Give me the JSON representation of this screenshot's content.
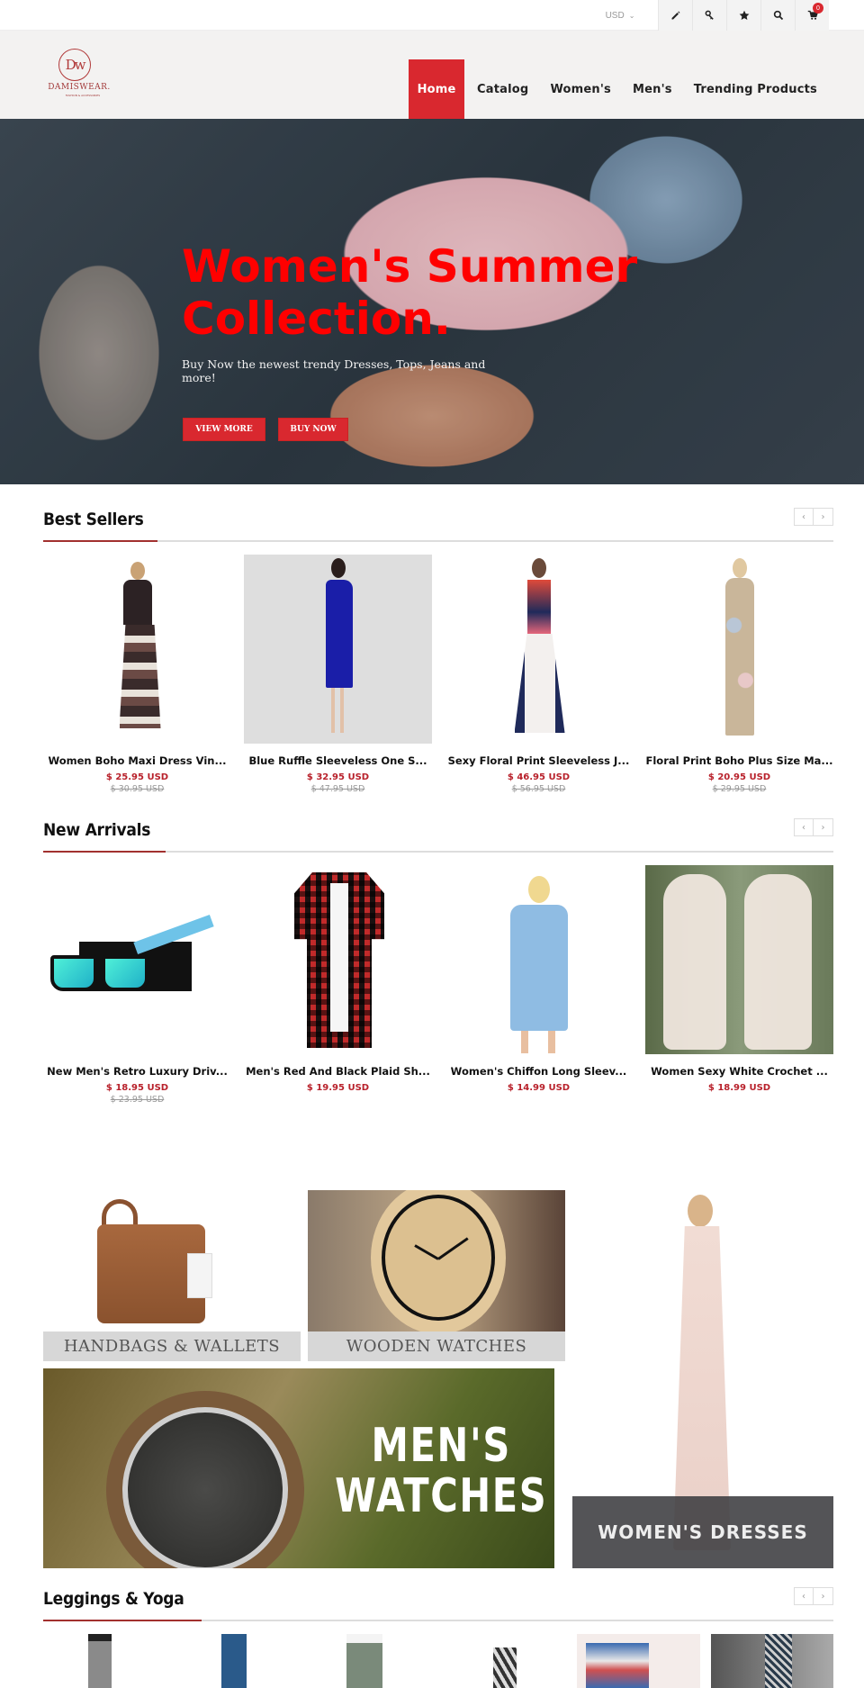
{
  "topbar": {
    "currency": "USD",
    "icons": [
      "pencil-icon",
      "key-icon",
      "star-icon",
      "search-icon",
      "cart-icon"
    ],
    "cart_count": "0"
  },
  "header": {
    "logo_mark": "Dw",
    "brand": "DAMISWEAR.",
    "tagline": "FASHION & ACCESSORIES",
    "nav": [
      "Home",
      "Catalog",
      "Women's",
      "Men's",
      "Trending Products"
    ],
    "active_nav": "Home"
  },
  "hero": {
    "title": "Women's Summer Collection.",
    "subtitle": "Buy Now the newest trendy Dresses, Tops, Jeans and more!",
    "buttons": [
      "VIEW MORE",
      "BUY NOW"
    ]
  },
  "best_sellers": {
    "title": "Best Sellers",
    "products": [
      {
        "name": "Women Boho Maxi Dress Vin...",
        "price": "$ 25.95 USD",
        "old_price": "$ 30.95 USD"
      },
      {
        "name": "Blue Ruffle Sleeveless One S...",
        "price": "$ 32.95 USD",
        "old_price": "$ 47.95 USD"
      },
      {
        "name": "Sexy Floral Print Sleeveless J...",
        "price": "$ 46.95 USD",
        "old_price": "$ 56.95 USD"
      },
      {
        "name": "Floral Print Boho Plus Size Ma...",
        "price": "$ 20.95 USD",
        "old_price": "$ 29.95 USD"
      }
    ]
  },
  "new_arrivals": {
    "title": "New Arrivals",
    "products": [
      {
        "name": "New Men's Retro Luxury Driv...",
        "price": "$ 18.95 USD",
        "old_price": "$ 23.95 USD"
      },
      {
        "name": "Men's Red And Black Plaid Sh...",
        "price": "$ 19.95 USD",
        "old_price": ""
      },
      {
        "name": "Women's Chiffon Long Sleev...",
        "price": "$ 14.99 USD",
        "old_price": ""
      },
      {
        "name": "Women Sexy White Crochet ...",
        "price": "$ 18.99 USD",
        "old_price": ""
      }
    ]
  },
  "promos": {
    "handbags": "HANDBAGS & WALLETS",
    "wooden_watches": "WOODEN WATCHES",
    "mens_watches_line1": "MEN'S",
    "mens_watches_line2": "WATCHES",
    "womens_dresses": "WOMEN'S DRESSES"
  },
  "leggings": {
    "title": "Leggings & Yoga"
  },
  "colors": {
    "accent": "#d9282f",
    "price": "#b8212b",
    "underline": "#a2302f"
  }
}
